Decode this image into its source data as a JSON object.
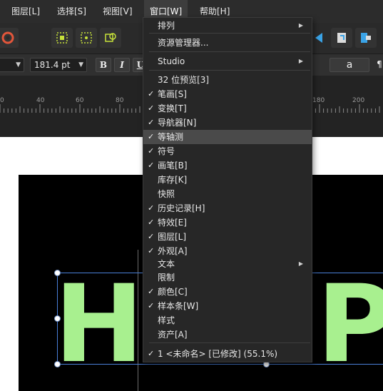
{
  "menubar": {
    "items": [
      {
        "label": "图层[L]"
      },
      {
        "label": "选择[S]"
      },
      {
        "label": "视图[V]"
      },
      {
        "label": "窗口[W]"
      },
      {
        "label": "帮助[H]"
      }
    ]
  },
  "contextbar": {
    "font_size": "181.4 pt",
    "bold": "B",
    "italic": "I",
    "underline": "U",
    "case_label": "a",
    "paragraph": "¶"
  },
  "ruler": {
    "labels": [
      "0",
      "40",
      "60",
      "80",
      "180",
      "200"
    ]
  },
  "canvas": {
    "text_chars": [
      "H",
      "P"
    ],
    "text_color": "#a8f08f"
  },
  "menu": {
    "items": [
      {
        "label": "排列",
        "checked": false,
        "submenu": true
      },
      {
        "label": "资源管理器...",
        "checked": false,
        "submenu": false
      },
      {
        "label": "Studio",
        "checked": false,
        "submenu": true
      },
      {
        "label": "32 位预览[3]",
        "checked": false,
        "submenu": false
      },
      {
        "label": "笔画[S]",
        "checked": true,
        "submenu": false
      },
      {
        "label": "变换[T]",
        "checked": true,
        "submenu": false
      },
      {
        "label": "导航器[N]",
        "checked": true,
        "submenu": false
      },
      {
        "label": "等轴测",
        "checked": true,
        "submenu": false,
        "highlighted": true
      },
      {
        "label": "符号",
        "checked": true,
        "submenu": false
      },
      {
        "label": "画笔[B]",
        "checked": true,
        "submenu": false
      },
      {
        "label": "库存[K]",
        "checked": false,
        "submenu": false
      },
      {
        "label": "快照",
        "checked": false,
        "submenu": false
      },
      {
        "label": "历史记录[H]",
        "checked": true,
        "submenu": false
      },
      {
        "label": "特效[E]",
        "checked": true,
        "submenu": false
      },
      {
        "label": "图层[L]",
        "checked": true,
        "submenu": false
      },
      {
        "label": "外观[A]",
        "checked": true,
        "submenu": false
      },
      {
        "label": "文本",
        "checked": false,
        "submenu": true
      },
      {
        "label": "限制",
        "checked": false,
        "submenu": false
      },
      {
        "label": "颜色[C]",
        "checked": true,
        "submenu": false
      },
      {
        "label": "样本条[W]",
        "checked": true,
        "submenu": false
      },
      {
        "label": "样式",
        "checked": false,
        "submenu": false
      },
      {
        "label": "资产[A]",
        "checked": false,
        "submenu": false
      },
      {
        "label": "1 <未命名> [已修改] (55.1%)",
        "checked": true,
        "submenu": false
      }
    ]
  }
}
